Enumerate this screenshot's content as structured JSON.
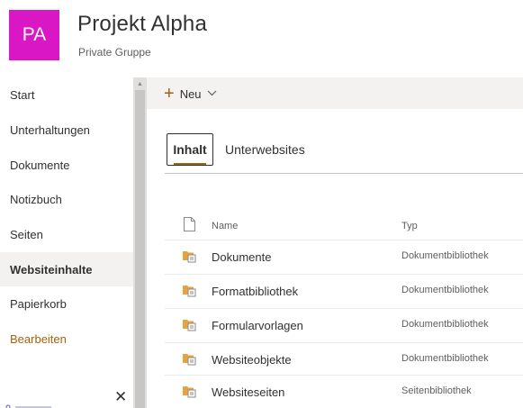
{
  "site": {
    "avatar_initials": "PA",
    "title": "Projekt Alpha",
    "subtitle": "Private Gruppe",
    "avatar_color": "#d917c5"
  },
  "nav": {
    "items": [
      {
        "label": "Start"
      },
      {
        "label": "Unterhaltungen"
      },
      {
        "label": "Dokumente"
      },
      {
        "label": "Notizbuch"
      },
      {
        "label": "Seiten"
      },
      {
        "label": "Websiteinhalte",
        "active": true
      },
      {
        "label": "Papierkorb"
      }
    ],
    "edit_label": "Bearbeiten"
  },
  "commandbar": {
    "new_label": "Neu",
    "new_icon": "plus-icon",
    "dropdown_icon": "chevron-down-icon"
  },
  "tabs": [
    {
      "label": "Inhalt",
      "selected": true
    },
    {
      "label": "Unterwebsites"
    }
  ],
  "list": {
    "headers": {
      "name": "Name",
      "type": "Typ"
    },
    "header_icon": "document-icon",
    "row_icon": "library-icon",
    "rows": [
      {
        "name": "Dokumente",
        "type": "Dokumentbibliothek"
      },
      {
        "name": "Formatbibliothek",
        "type": "Dokumentbibliothek"
      },
      {
        "name": "Formularvorlagen",
        "type": "Dokumentbibliothek"
      },
      {
        "name": "Websiteobjekte",
        "type": "Dokumentbibliothek"
      },
      {
        "name": "Websiteseiten",
        "type": "Seitenbibliothek"
      }
    ]
  },
  "colors": {
    "accent": "#a4620e",
    "nav_active_bg": "#f3f2f1",
    "commandbar_bg": "#f3f2f1"
  }
}
